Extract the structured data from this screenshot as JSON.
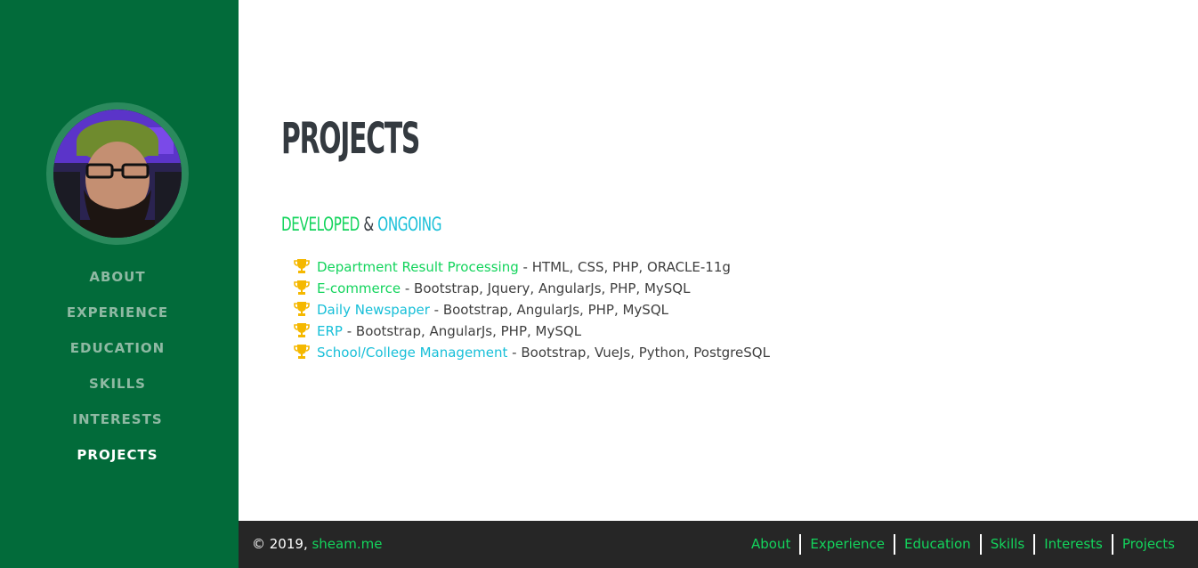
{
  "sidebar": {
    "nav": [
      {
        "label": "ABOUT",
        "active": false
      },
      {
        "label": "EXPERIENCE",
        "active": false
      },
      {
        "label": "EDUCATION",
        "active": false
      },
      {
        "label": "SKILLS",
        "active": false
      },
      {
        "label": "INTERESTS",
        "active": false
      },
      {
        "label": "PROJECTS",
        "active": true
      }
    ]
  },
  "main": {
    "title": "PROJECTS",
    "subtitle": {
      "part1": "DEVELOPED",
      "sep": " & ",
      "part2": "ONGOING"
    },
    "projects": [
      {
        "name": "Department Result Processing",
        "tech": " - HTML, CSS, PHP, ORACLE-11g",
        "color": "green"
      },
      {
        "name": "E-commerce",
        "tech": " - Bootstrap, Jquery, AngularJs, PHP, MySQL",
        "color": "green"
      },
      {
        "name": "Daily Newspaper",
        "tech": " - Bootstrap, AngularJs, PHP, MySQL",
        "color": "cyan"
      },
      {
        "name": "ERP",
        "tech": " - Bootstrap, AngularJs, PHP, MySQL",
        "color": "cyan"
      },
      {
        "name": "School/College Management",
        "tech": " - Bootstrap, VueJs, Python, PostgreSQL",
        "color": "cyan"
      }
    ],
    "item_icon": "trophy-icon"
  },
  "footer": {
    "copyright_prefix": "© 2019, ",
    "site_link": "sheam.me",
    "links": [
      "About",
      "Experience",
      "Education",
      "Skills",
      "Interests",
      "Projects"
    ]
  },
  "colors": {
    "sidebar_bg": "#026b3a",
    "accent_green": "#13d45c",
    "accent_cyan": "#17bfd8",
    "footer_bg": "#262626",
    "trophy": "#f5b800"
  }
}
